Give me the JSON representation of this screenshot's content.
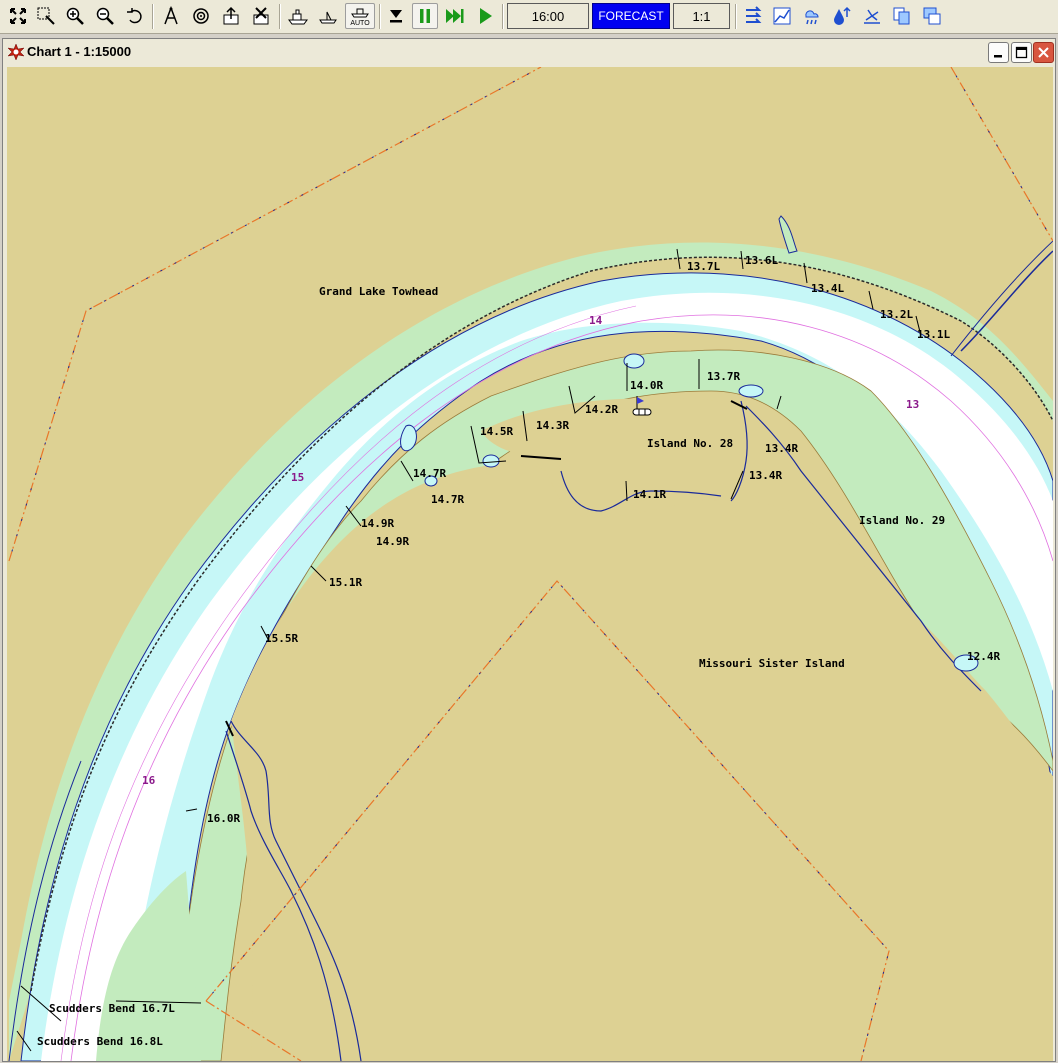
{
  "toolbar": {
    "clock": "16:00",
    "forecast_label": "FORECAST",
    "scale_label": "1:1",
    "auto_label": "AUTO"
  },
  "window": {
    "title": "Chart 1 - 1:15000"
  },
  "chart": {
    "place_names": {
      "grand_lake_towhead": "Grand Lake Towhead",
      "island_28": "Island No. 28",
      "island_29": "Island No. 29",
      "missouri_sister": "Missouri Sister Island",
      "scudders_bend_7": "Scudders Bend 16.7L",
      "scudders_bend_8": "Scudders Bend 16.8L"
    },
    "river_miles": {
      "m13": "13",
      "m14": "14",
      "m15": "15",
      "m16": "16"
    },
    "mile_markers": {
      "m13_7l": "13.7L",
      "m13_6l": "13.6L",
      "m13_4l": "13.4L",
      "m13_2l": "13.2L",
      "m13_1l": "13.1L",
      "m14_0r": "14.0R",
      "m13_7r": "13.7R",
      "m14_2r": "14.2R",
      "m14_3r": "14.3R",
      "m14_5r": "14.5R",
      "m13_4r_a": "13.4R",
      "m13_4r_b": "13.4R",
      "m14_7r_a": "14.7R",
      "m14_7r_b": "14.7R",
      "m14_1r": "14.1R",
      "m14_9r_a": "14.9R",
      "m14_9r_b": "14.9R",
      "m15_1r": "15.1R",
      "m15_5r": "15.5R",
      "m12_4r": "12.4R",
      "m16_0r": "16.0R"
    },
    "colors": {
      "land": "#ddd193",
      "vegetation": "#c3ebbe",
      "shallow_water": "#c6f7f7",
      "deep_water": "#ffffff",
      "boundary_orange": "#e8772a",
      "boundary_navy": "#1a2a9a",
      "river_mile_label": "#8b1a8b"
    }
  }
}
